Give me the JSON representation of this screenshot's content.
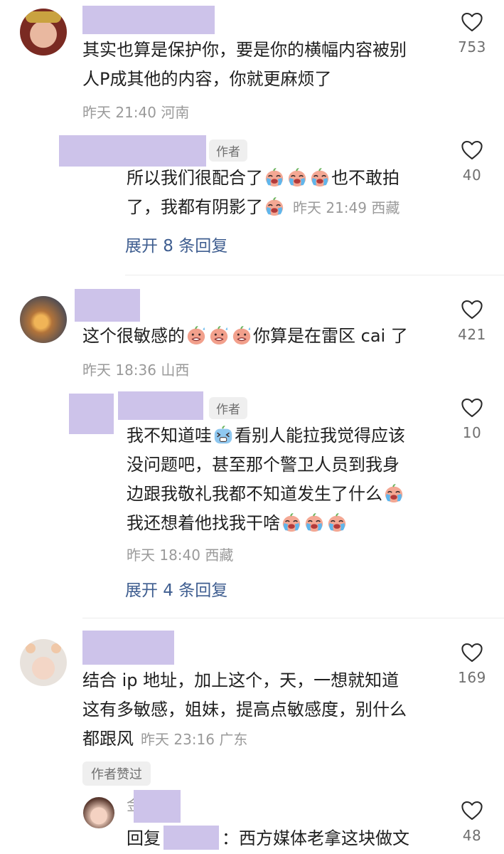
{
  "comments": [
    {
      "avatar": "avatar-woman-red-headdress",
      "text_lines": [
        "其实也算是保护你，要是你的横幅内容被别",
        "人P成其他的内容，你就更麻烦了"
      ],
      "time": "昨天 21:40 河南",
      "likes": "753",
      "reply": {
        "tag": "作者",
        "line1_text": "所以我们很配合了",
        "line1_tail": "也不敢拍",
        "line2_text": "了，我都有阴影了",
        "meta": "昨天 21:49 西藏",
        "likes": "40"
      },
      "expand": "展开 8 条回复"
    },
    {
      "avatar": "avatar-sunset-clouds",
      "text_head": "这个很敏感的",
      "text_tail": "你算是在雷区 cai 了",
      "time": "昨天 18:36 山西",
      "likes": "421",
      "reply": {
        "tag": "作者",
        "line1_head": "我不知道哇",
        "line1_tail": "看别人能拉我觉得应该",
        "line2": "没问题吧，甚至那个警卫人员到我身",
        "line3": "边跟我敬礼我都不知道发生了什么",
        "line4": "我还想着他找我干啥",
        "meta": "昨天 18:40 西藏",
        "likes": "10"
      },
      "expand": "展开 4 条回复"
    },
    {
      "avatar": "avatar-baby-girl",
      "text_lines": [
        "结合 ip 地址，加上这个，天，一想就知道",
        "这有多敏感，姐妹，提高点敏感度，别什么"
      ],
      "line3": "都跟风",
      "time_inline": "昨天 23:16 广东",
      "likes": "169",
      "author_liked": "作者赞过",
      "reply": {
        "name_partial": "金",
        "prefix": "回复",
        "text": "：西方媒体老拿这块做文",
        "likes": "48"
      }
    }
  ],
  "colors": {
    "redaction": "#cdc3ea",
    "link": "#3f5e90"
  },
  "icons": {
    "like": "heart-outline-icon",
    "emoji_cry": "crying-emoji-icon",
    "emoji_grimace": "grimace-emoji-icon"
  }
}
